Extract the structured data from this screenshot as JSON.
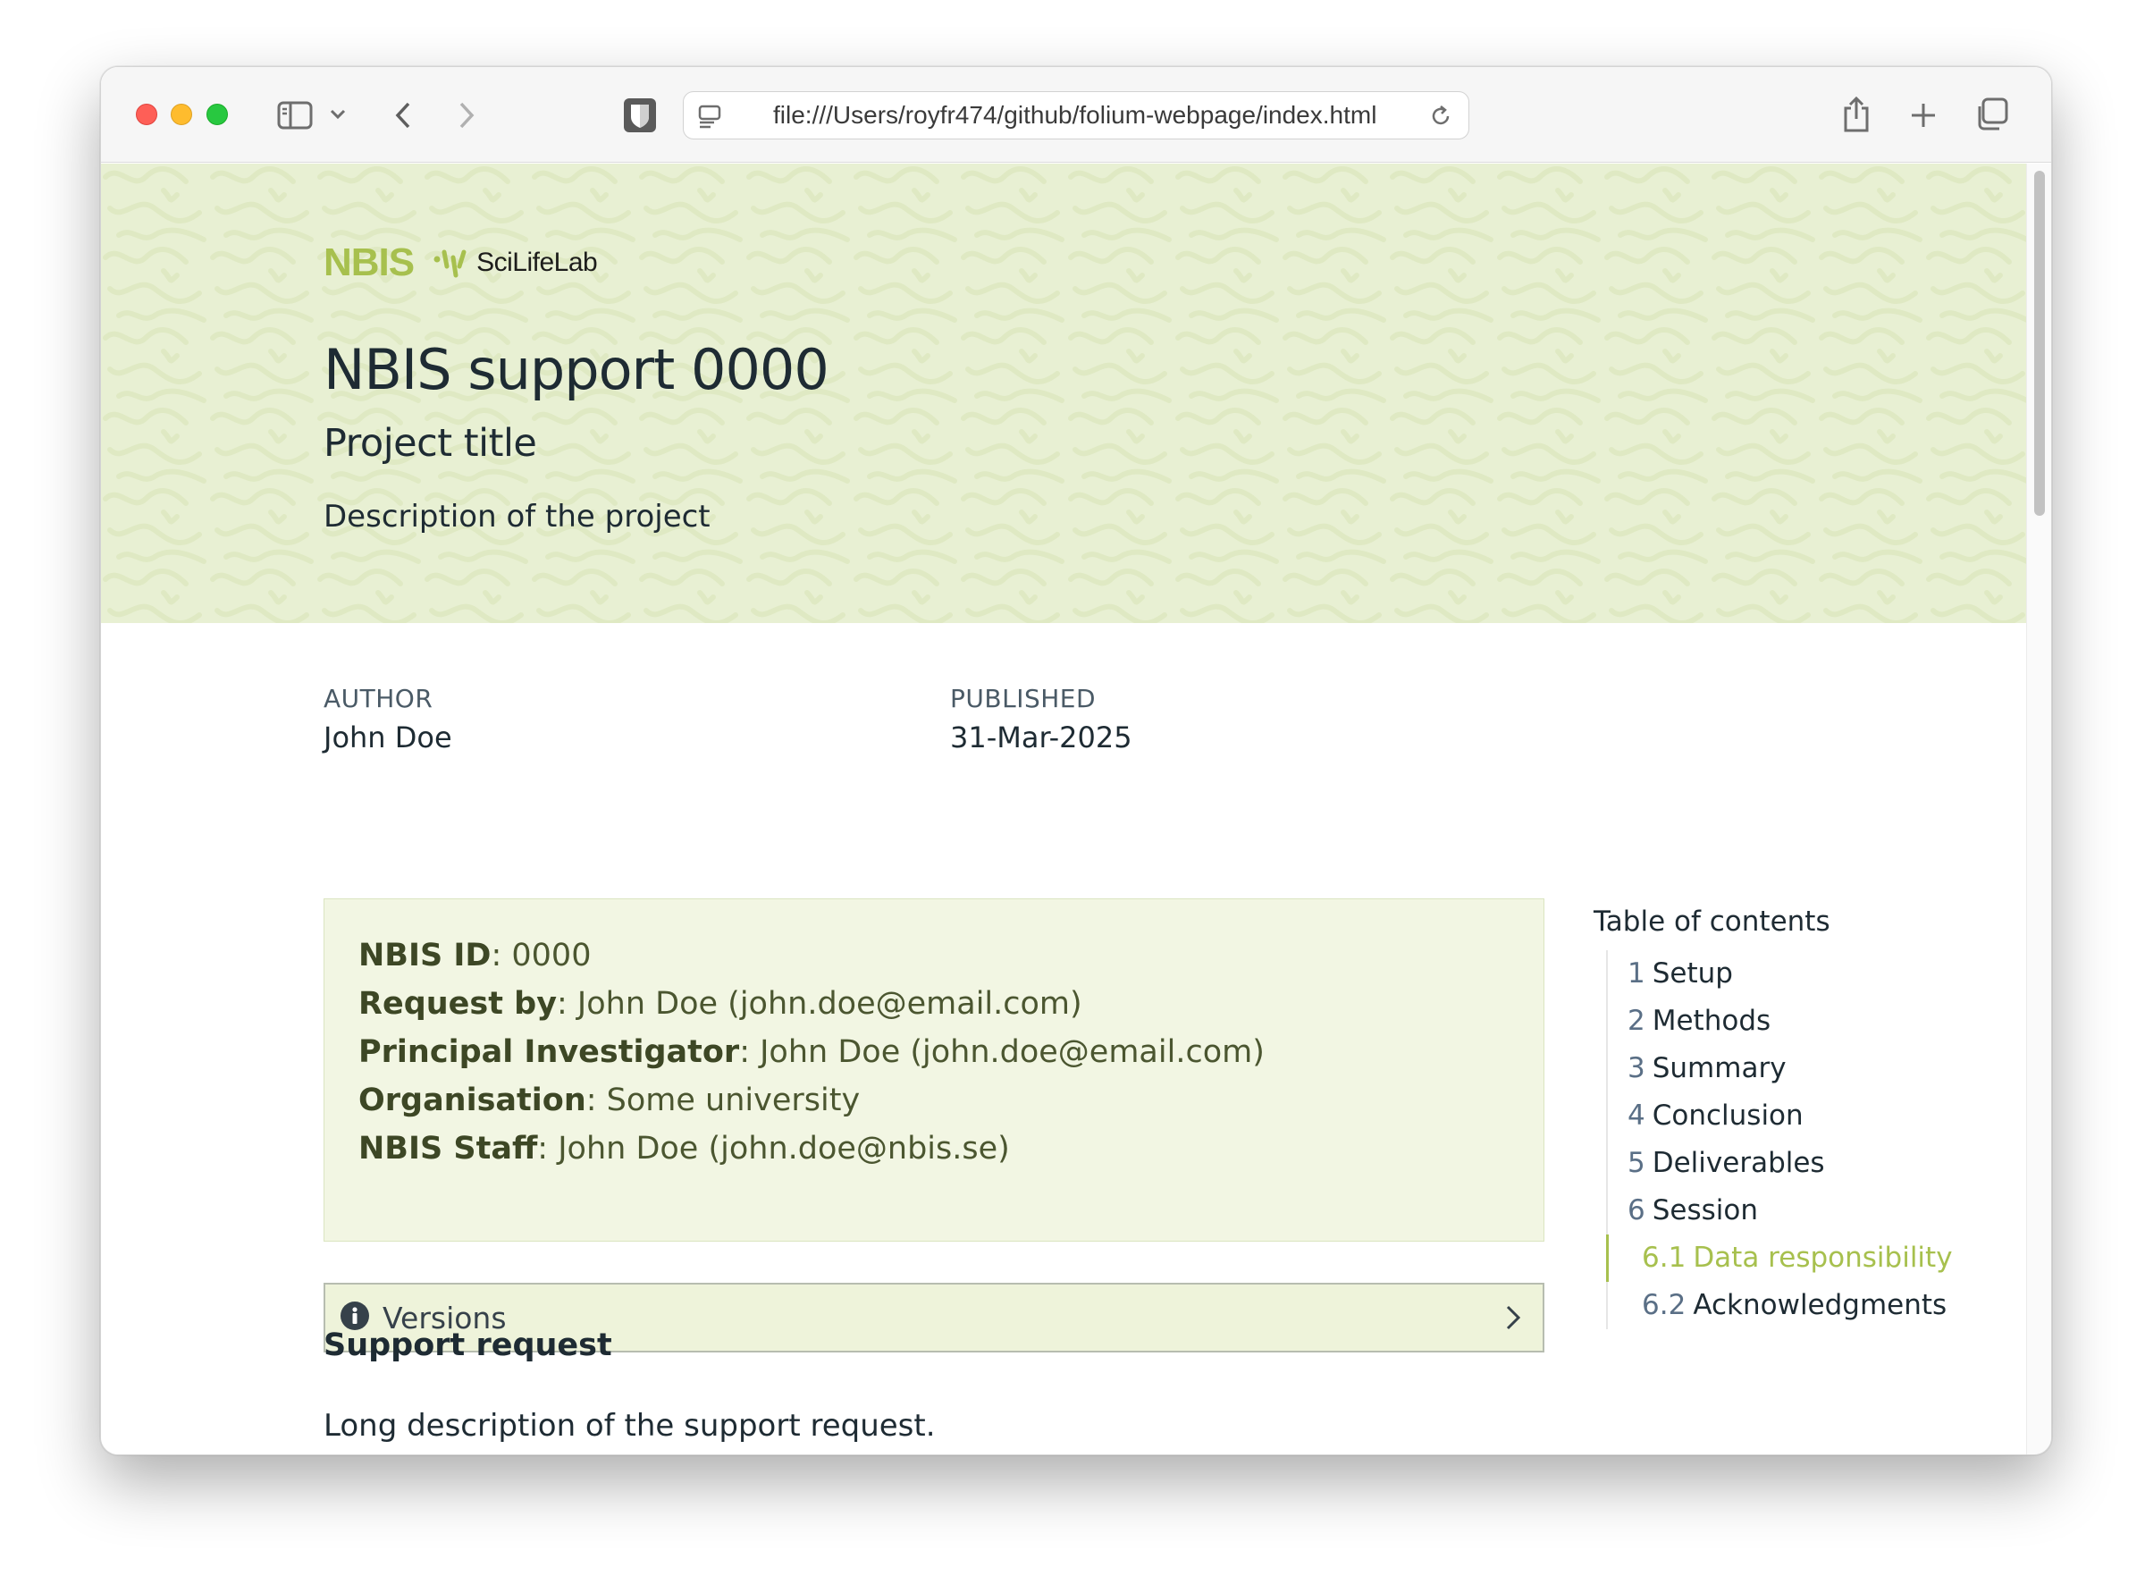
{
  "browser": {
    "url": "file:///Users/royfr474/github/folium-webpage/index.html"
  },
  "header": {
    "logo_nbis": "NBIS",
    "logo_scilifelab": "SciLifeLab",
    "title": "NBIS support 0000",
    "subtitle": "Project title",
    "description": "Description of the project"
  },
  "meta": {
    "author_label": "AUTHOR",
    "author_value": "John Doe",
    "published_label": "PUBLISHED",
    "published_value": "31-Mar-2025"
  },
  "info": {
    "lines": [
      {
        "label": "NBIS ID",
        "value": ": 0000"
      },
      {
        "label": "Request by",
        "value": ": John Doe (john.doe@email.com)"
      },
      {
        "label": "Principal Investigator",
        "value": ": John Doe (john.doe@email.com)"
      },
      {
        "label": "Organisation",
        "value": ": Some university"
      },
      {
        "label": "NBIS Staff",
        "value": ": John Doe (john.doe@nbis.se)"
      }
    ]
  },
  "versions": {
    "label": "Versions"
  },
  "support": {
    "heading": "Support request",
    "text": "Long description of the support request."
  },
  "toc": {
    "title": "Table of contents",
    "items": [
      {
        "num": "1",
        "label": "Setup"
      },
      {
        "num": "2",
        "label": "Methods"
      },
      {
        "num": "3",
        "label": "Summary"
      },
      {
        "num": "4",
        "label": "Conclusion"
      },
      {
        "num": "5",
        "label": "Deliverables"
      },
      {
        "num": "6",
        "label": "Session"
      },
      {
        "num": "6.1",
        "label": "Data responsibility"
      },
      {
        "num": "6.2",
        "label": "Acknowledgments"
      }
    ]
  },
  "colors": {
    "accent": "#a7c04e",
    "banner": "#e8f0d3",
    "infobox": "#f2f6e3"
  }
}
